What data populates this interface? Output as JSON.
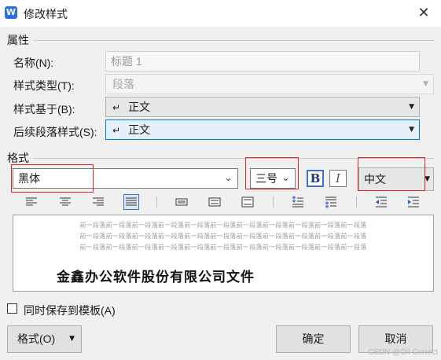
{
  "window": {
    "icon_letter": "W",
    "title": "修改样式",
    "close_glyph": "✕"
  },
  "properties": {
    "section_label": "属性",
    "name_label": "名称(N):",
    "name_value": "标题 1",
    "style_type_label": "样式类型(T):",
    "style_type_value": "段落",
    "based_on_label": "样式基于(B):",
    "based_on_value": "正文",
    "next_style_label": "后续段落样式(S):",
    "next_style_value": "正文",
    "paragraph_mark": "↵"
  },
  "format": {
    "section_label": "格式",
    "font_value": "黑体",
    "size_value": "三号",
    "bold_label": "B",
    "italic_label": "I",
    "language_value": "中文",
    "highlight_color": "#e0242a"
  },
  "toolbar": {
    "icons": [
      "align-left-icon",
      "align-center-icon",
      "align-right-icon",
      "align-justify-icon",
      "line-spacing-single-icon",
      "line-spacing-1-5-icon",
      "line-spacing-double-icon",
      "space-before-increase-icon",
      "space-after-increase-icon",
      "indent-decrease-icon",
      "indent-increase-icon"
    ]
  },
  "preview": {
    "prev_paragraph_lines": [
      "前一段落前一段落前一段落前一段落前一段落前一段落前一段落前一段落前一段落前一段落前一段落",
      "前一段落前一段落前一段落前一段落前一段落前一段落前一段落前一段落前一段落前一段落前一段落",
      "前一段落前一段落前一段落前一段落前一段落前一段落前一段落前一段落前一段落前一段落前一段落"
    ],
    "sample_text": "金鑫办公软件股份有限公司文件"
  },
  "footer": {
    "save_template_label": "同时保存到模板(A)",
    "format_button_label": "格式(O)",
    "ok_label": "确定",
    "cancel_label": "取消",
    "watermark": "CSDN @Oil Correct"
  }
}
